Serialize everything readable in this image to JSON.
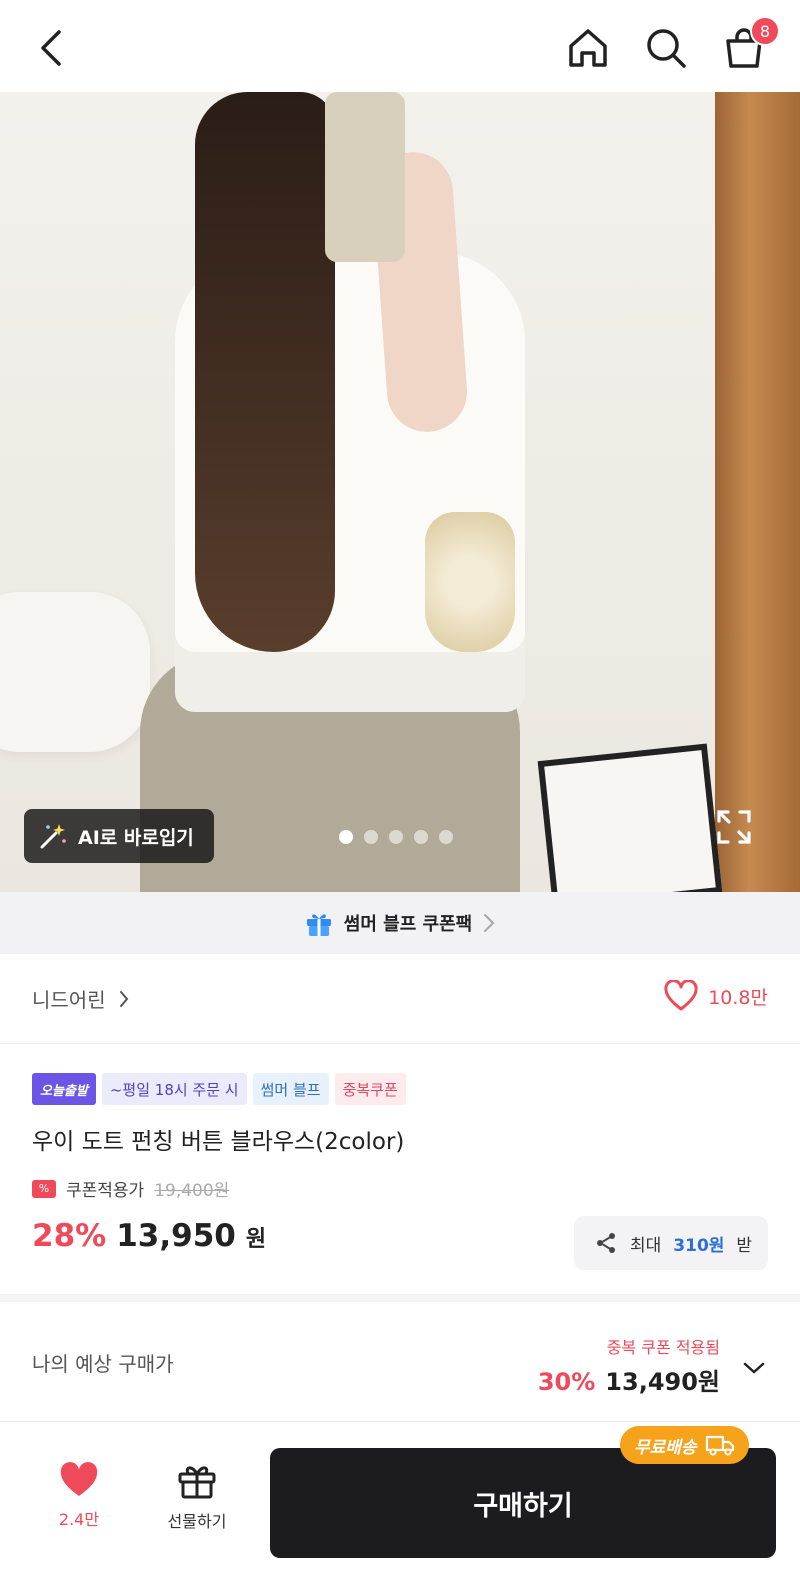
{
  "header": {
    "cart_count": "8",
    "icons": [
      "back-icon",
      "home-icon",
      "search-icon",
      "shopping-bag-icon"
    ]
  },
  "hero": {
    "ai_button_label": "AI로 바로입기",
    "image_count": 5,
    "active_image_index": 0
  },
  "coupon_banner": {
    "label": "썸머 블프 쿠폰팩"
  },
  "store": {
    "name": "니드어린",
    "likes": "10.8만"
  },
  "product": {
    "tags": {
      "today_ship": "오늘출발",
      "cutoff": "~평일 18시 주문 시",
      "event": "썸머 블프",
      "coupon": "중복쿠폰"
    },
    "title": "우이 도트 펀칭 버튼 블라우스(2color)",
    "coupon_price_label": "쿠폰적용가",
    "original_price": "19,400원",
    "discount": "28%",
    "price": "13,950",
    "currency": "원",
    "share": {
      "prefix": "최대",
      "amount": "310원",
      "suffix": "받"
    }
  },
  "expected_price": {
    "label": "나의 예상 구매가",
    "note": "중복 쿠폰 적용됨",
    "discount": "30%",
    "price": "13,490원"
  },
  "bottom_bar": {
    "wishlist_count": "2.4만",
    "gift_label": "선물하기",
    "buy_label": "구매하기",
    "free_shipping_label": "무료배송"
  },
  "colors": {
    "accent_red": "#ef4a5a",
    "buy_button": "#1c1c1e",
    "free_shipping": "#f6a21b",
    "link_blue": "#2b6fd6"
  }
}
